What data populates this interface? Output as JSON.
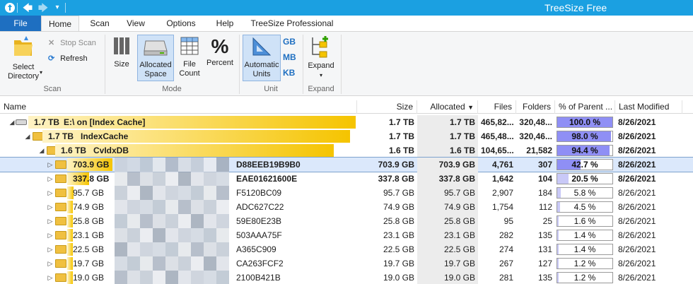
{
  "app": {
    "title": "TreeSize Free",
    "accent": "#1ba0e1"
  },
  "ribbon_tabs": [
    "File",
    "Home",
    "Scan",
    "View",
    "Options",
    "Help",
    "TreeSize Professional"
  ],
  "ribbon": {
    "scan_group": {
      "label": "Scan",
      "select_directory": "Select\nDirectory",
      "stop_scan": "Stop Scan",
      "refresh": "Refresh"
    },
    "mode_group": {
      "label": "Mode",
      "size": "Size",
      "allocated_space": "Allocated\nSpace",
      "file_count": "File\nCount",
      "percent": "Percent"
    },
    "unit_group": {
      "label": "Unit",
      "automatic_units": "Automatic\nUnits",
      "gb": "GB",
      "mb": "MB",
      "kb": "KB"
    },
    "expand_group": {
      "label": "Expand",
      "expand": "Expand"
    }
  },
  "columns": [
    "Name",
    "Size",
    "Allocated",
    "Files",
    "Folders",
    "% of Parent ...",
    "Last Modified"
  ],
  "rows": [
    {
      "level": 0,
      "size_label": "1.7 TB",
      "name": "E:\\  on  [Index Cache]",
      "name_suffix": "",
      "size": "1.7 TB",
      "allocated": "1.7 TB",
      "files": "465,82...",
      "folders": "320,48...",
      "pct": "100.0 %",
      "pct_value": 100.0,
      "modified": "8/26/2021",
      "bold": true,
      "selected": false,
      "bar_fraction": 1.0,
      "drive": true
    },
    {
      "level": 1,
      "size_label": "1.7 TB",
      "name": "IndexCache",
      "name_suffix": "",
      "size": "1.7 TB",
      "allocated": "1.7 TB",
      "files": "465,48...",
      "folders": "320,46...",
      "pct": "98.0 %",
      "pct_value": 98.0,
      "modified": "8/26/2021",
      "bold": true,
      "selected": false,
      "bar_fraction": 0.98
    },
    {
      "level": 2,
      "size_label": "1.6 TB",
      "name": "CvIdxDB",
      "name_suffix": "",
      "size": "1.6 TB",
      "allocated": "1.6 TB",
      "files": "104,65...",
      "folders": "21,582",
      "pct": "94.4 %",
      "pct_value": 94.4,
      "modified": "8/26/2021",
      "bold": true,
      "selected": false,
      "bar_fraction": 0.944
    },
    {
      "level": 3,
      "size_label": "703.9 GB",
      "name": "",
      "name_suffix": "D88EEB19B9B0",
      "size": "703.9 GB",
      "allocated": "703.9 GB",
      "files": "4,761",
      "folders": "307",
      "pct": "42.7 %",
      "pct_value": 42.7,
      "modified": "8/26/2021",
      "bold": true,
      "selected": true,
      "bar_fraction": 0.427
    },
    {
      "level": 3,
      "size_label": "337.8 GB",
      "name": "",
      "name_suffix": "EAE01621600E",
      "size": "337.8 GB",
      "allocated": "337.8 GB",
      "files": "1,642",
      "folders": "104",
      "pct": "20.5 %",
      "pct_value": 20.5,
      "modified": "8/26/2021",
      "bold": true,
      "selected": false,
      "bar_fraction": 0.205
    },
    {
      "level": 3,
      "size_label": "95.7 GB",
      "name": "",
      "name_suffix": "F5120BC09",
      "size": "95.7 GB",
      "allocated": "95.7 GB",
      "files": "2,907",
      "folders": "184",
      "pct": "5.8 %",
      "pct_value": 5.8,
      "modified": "8/26/2021",
      "bold": false,
      "selected": false,
      "bar_fraction": 0.058
    },
    {
      "level": 3,
      "size_label": "74.9 GB",
      "name": "",
      "name_suffix": "ADC627C22",
      "size": "74.9 GB",
      "allocated": "74.9 GB",
      "files": "1,754",
      "folders": "112",
      "pct": "4.5 %",
      "pct_value": 4.5,
      "modified": "8/26/2021",
      "bold": false,
      "selected": false,
      "bar_fraction": 0.045
    },
    {
      "level": 3,
      "size_label": "25.8 GB",
      "name": "",
      "name_suffix": "59E80E23B",
      "size": "25.8 GB",
      "allocated": "25.8 GB",
      "files": "95",
      "folders": "25",
      "pct": "1.6 %",
      "pct_value": 1.6,
      "modified": "8/26/2021",
      "bold": false,
      "selected": false,
      "bar_fraction": 0.016
    },
    {
      "level": 3,
      "size_label": "23.1 GB",
      "name": "",
      "name_suffix": "503AAA75F",
      "size": "23.1 GB",
      "allocated": "23.1 GB",
      "files": "282",
      "folders": "135",
      "pct": "1.4 %",
      "pct_value": 1.4,
      "modified": "8/26/2021",
      "bold": false,
      "selected": false,
      "bar_fraction": 0.014
    },
    {
      "level": 3,
      "size_label": "22.5 GB",
      "name": "",
      "name_suffix": "A365C909",
      "size": "22.5 GB",
      "allocated": "22.5 GB",
      "files": "274",
      "folders": "131",
      "pct": "1.4 %",
      "pct_value": 1.4,
      "modified": "8/26/2021",
      "bold": false,
      "selected": false,
      "bar_fraction": 0.014
    },
    {
      "level": 3,
      "size_label": "19.7 GB",
      "name": "",
      "name_suffix": "CA263FCF2",
      "size": "19.7 GB",
      "allocated": "19.7 GB",
      "files": "267",
      "folders": "127",
      "pct": "1.2 %",
      "pct_value": 1.2,
      "modified": "8/26/2021",
      "bold": false,
      "selected": false,
      "bar_fraction": 0.012
    },
    {
      "level": 3,
      "size_label": "19.0 GB",
      "name": "",
      "name_suffix": "2100B421B",
      "size": "19.0 GB",
      "allocated": "19.0 GB",
      "files": "281",
      "folders": "135",
      "pct": "1.2 %",
      "pct_value": 1.2,
      "modified": "8/26/2021",
      "bold": false,
      "selected": false,
      "bar_fraction": 0.012
    }
  ],
  "colors": {
    "bar_gradient_start": "#fff3c4",
    "bar_gradient_end": "#f5c400",
    "pct_fill_big": "#8f8ff5",
    "pct_fill_small": "#c9c9f7",
    "selection": "#dbe8fb"
  }
}
